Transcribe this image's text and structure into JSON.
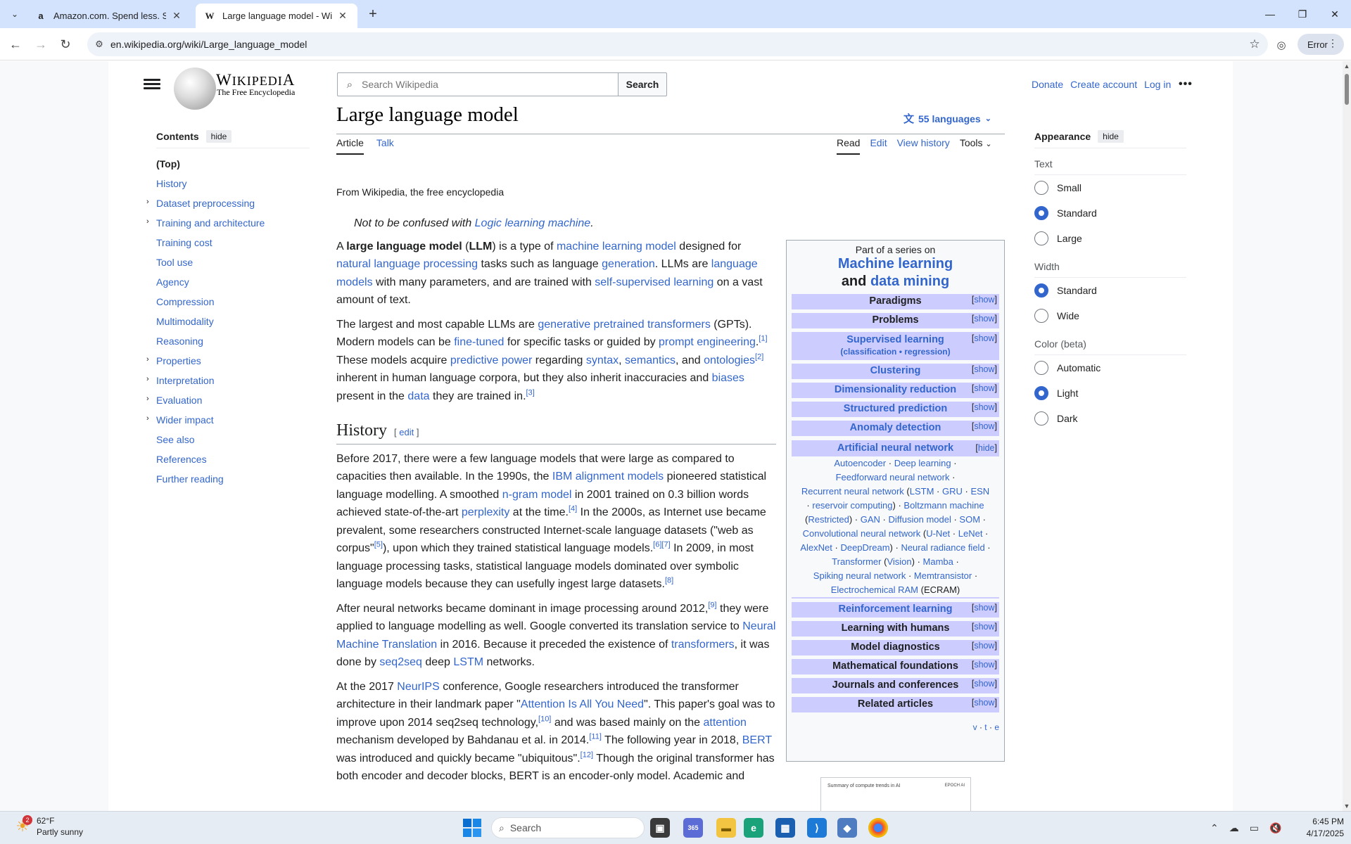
{
  "browser": {
    "tabs": [
      {
        "title": "Amazon.com. Spend less. Smile more.",
        "favicon": "amazon-icon",
        "active": false
      },
      {
        "title": "Large language model - Wikipedia",
        "favicon": "wikipedia-icon",
        "active": true
      }
    ],
    "url": "en.wikipedia.org/wiki/Large_language_model",
    "error_label": "Error"
  },
  "header": {
    "wordmark": "Wikipedia",
    "tagline": "The Free Encyclopedia",
    "search_placeholder": "Search Wikipedia",
    "search_button": "Search",
    "donate": "Donate",
    "create_account": "Create account",
    "login": "Log in"
  },
  "toc": {
    "title": "Contents",
    "hide": "hide",
    "items": [
      {
        "label": "(Top)",
        "expandable": false
      },
      {
        "label": "History",
        "expandable": false
      },
      {
        "label": "Dataset preprocessing",
        "expandable": true
      },
      {
        "label": "Training and architecture",
        "expandable": true
      },
      {
        "label": "Training cost",
        "expandable": false
      },
      {
        "label": "Tool use",
        "expandable": false
      },
      {
        "label": "Agency",
        "expandable": false
      },
      {
        "label": "Compression",
        "expandable": false
      },
      {
        "label": "Multimodality",
        "expandable": false
      },
      {
        "label": "Reasoning",
        "expandable": false
      },
      {
        "label": "Properties",
        "expandable": true
      },
      {
        "label": "Interpretation",
        "expandable": true
      },
      {
        "label": "Evaluation",
        "expandable": true
      },
      {
        "label": "Wider impact",
        "expandable": true
      },
      {
        "label": "See also",
        "expandable": false
      },
      {
        "label": "References",
        "expandable": false
      },
      {
        "label": "Further reading",
        "expandable": false
      }
    ]
  },
  "article": {
    "title": "Large language model",
    "languages": "55 languages",
    "tab_article": "Article",
    "tab_talk": "Talk",
    "tab_read": "Read",
    "tab_edit": "Edit",
    "tab_history": "View history",
    "tab_tools": "Tools",
    "from": "From Wikipedia, the free encyclopedia",
    "hatnote_prefix": "Not to be confused with ",
    "hatnote_link": "Logic learning machine",
    "history_heading": "History",
    "edit_label": "edit"
  },
  "sidebar_box": {
    "part_of": "Part of a series on",
    "title1": "Machine learning",
    "and": "and",
    "title2": "data mining",
    "show": "show",
    "hide": "hide",
    "rows_top": [
      {
        "label": "Paradigms",
        "link": false
      },
      {
        "label": "Problems",
        "link": false
      }
    ],
    "supervised": {
      "label": "Supervised learning",
      "sub1": "classification",
      "sub2": "regression"
    },
    "rows_mid": [
      {
        "label": "Clustering"
      },
      {
        "label": "Dimensionality reduction"
      },
      {
        "label": "Structured prediction"
      },
      {
        "label": "Anomaly detection"
      }
    ],
    "ann_title": "Artificial neural network",
    "rows_bottom": [
      {
        "label": "Reinforcement learning",
        "link": true
      },
      {
        "label": "Learning with humans",
        "link": false
      },
      {
        "label": "Model diagnostics",
        "link": false
      },
      {
        "label": "Mathematical foundations",
        "link": false
      },
      {
        "label": "Journals and conferences",
        "link": false
      },
      {
        "label": "Related articles",
        "link": false
      }
    ],
    "vte": [
      "v",
      "t",
      "e"
    ]
  },
  "thumbnail": {
    "caption": "Summary of compute trends in AI",
    "logo": "EPOCH AI"
  },
  "appearance": {
    "title": "Appearance",
    "hide": "hide",
    "text_label": "Text",
    "text_options": [
      {
        "label": "Small",
        "selected": false
      },
      {
        "label": "Standard",
        "selected": true
      },
      {
        "label": "Large",
        "selected": false
      }
    ],
    "width_label": "Width",
    "width_options": [
      {
        "label": "Standard",
        "selected": true
      },
      {
        "label": "Wide",
        "selected": false
      }
    ],
    "color_label": "Color (beta)",
    "color_options": [
      {
        "label": "Automatic",
        "selected": false
      },
      {
        "label": "Light",
        "selected": true
      },
      {
        "label": "Dark",
        "selected": false
      }
    ]
  },
  "taskbar": {
    "temp": "62°F",
    "condition": "Partly sunny",
    "weather_badge": "2",
    "search_placeholder": "Search",
    "time": "6:45 PM",
    "date": "4/17/2025"
  },
  "colors": {
    "link": "#3366cc",
    "navbox_header": "#ccccff",
    "tabbar": "#d3e3fd"
  }
}
